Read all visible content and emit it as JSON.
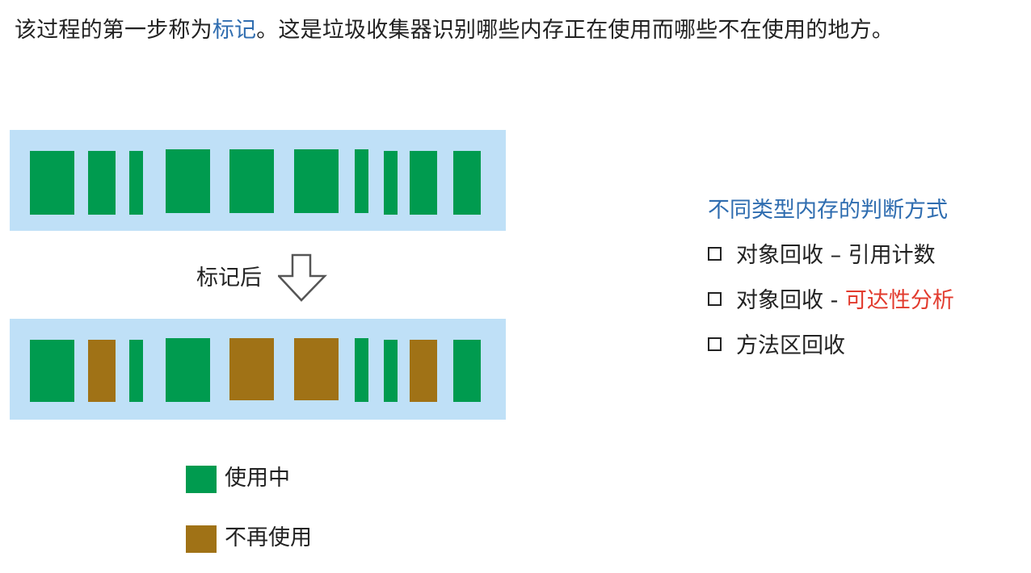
{
  "intro": {
    "before": "该过程的第一步称为",
    "highlight": "标记",
    "after": "。这是垃圾收集器识别哪些内存正在使用而哪些不在使用的地方。"
  },
  "arrow_label": "标记后",
  "legend": {
    "in_use": "使用中",
    "not_used": "不再使用"
  },
  "side_panel": {
    "title": "不同类型内存的判断方式",
    "items": [
      {
        "text": "对象回收 – 引用计数",
        "highlight": ""
      },
      {
        "text": "对象回收 - ",
        "highlight": "可达性分析"
      },
      {
        "text": "方法区回收",
        "highlight": ""
      }
    ]
  },
  "blocks": {
    "before": [
      "in_use",
      "in_use",
      "in_use",
      "in_use",
      "in_use",
      "in_use",
      "in_use",
      "in_use",
      "in_use",
      "in_use"
    ],
    "after": [
      "in_use",
      "not_used",
      "in_use",
      "in_use",
      "not_used",
      "not_used",
      "in_use",
      "in_use",
      "not_used",
      "in_use"
    ]
  },
  "colors": {
    "in_use": "#009b4f",
    "not_used": "#a07216",
    "panel_bg": "#bfe0f7",
    "highlight_blue": "#2f6db0",
    "highlight_red": "#e23b2e"
  }
}
